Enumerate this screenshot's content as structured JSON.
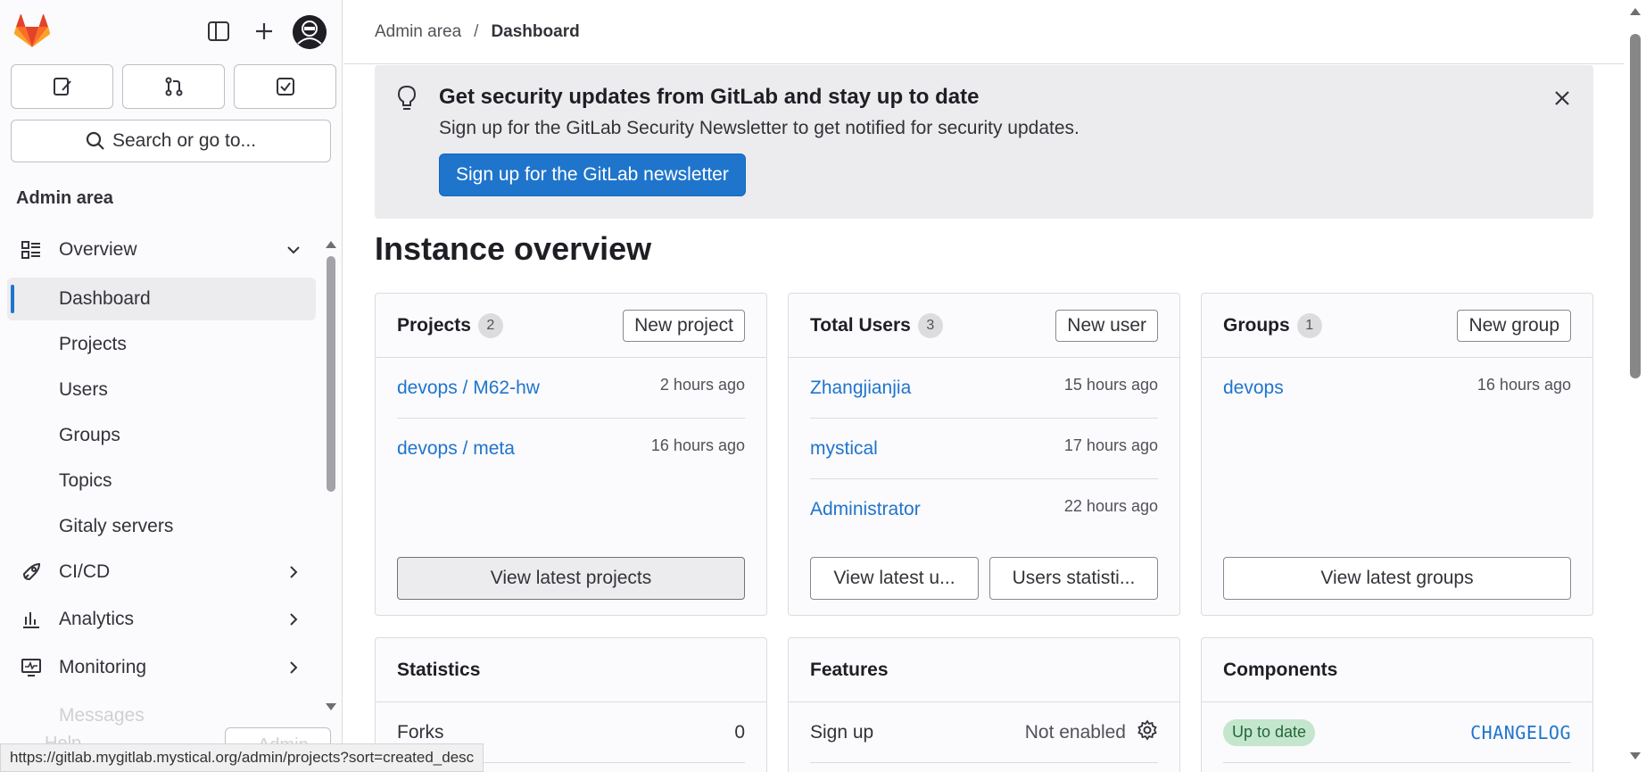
{
  "sidebar": {
    "section_title": "Admin area",
    "search_label": "Search or go to...",
    "nav": [
      {
        "label": "Overview",
        "icon": "overview-icon",
        "expanded": true
      },
      {
        "label": "Dashboard",
        "active": true
      },
      {
        "label": "Projects"
      },
      {
        "label": "Users"
      },
      {
        "label": "Groups"
      },
      {
        "label": "Topics"
      },
      {
        "label": "Gitaly servers"
      },
      {
        "label": "CI/CD",
        "icon": "rocket-icon"
      },
      {
        "label": "Analytics",
        "icon": "chart-icon"
      },
      {
        "label": "Monitoring",
        "icon": "monitor-icon"
      },
      {
        "label": "Messages"
      }
    ],
    "help_label": "Help",
    "admin_label": "Admin"
  },
  "breadcrumb": {
    "first": "Admin area",
    "separator": "/",
    "current": "Dashboard"
  },
  "banner": {
    "title": "Get security updates from GitLab and stay up to date",
    "text": "Sign up for the GitLab Security Newsletter to get notified for security updates.",
    "button": "Sign up for the GitLab newsletter"
  },
  "page_title": "Instance overview",
  "projects_card": {
    "title": "Projects",
    "count": "2",
    "new_button": "New project",
    "rows": [
      {
        "name": "devops / M62-hw",
        "time": "2 hours ago"
      },
      {
        "name": "devops / meta",
        "time": "16 hours ago"
      }
    ],
    "footer_button": "View latest projects"
  },
  "users_card": {
    "title": "Total Users",
    "count": "3",
    "new_button": "New user",
    "rows": [
      {
        "name": "Zhangjianjia",
        "time": "15 hours ago"
      },
      {
        "name": "mystical",
        "time": "17 hours ago"
      },
      {
        "name": "Administrator",
        "time": "22 hours ago"
      }
    ],
    "footer_buttons": [
      "View latest u...",
      "Users statisti..."
    ]
  },
  "groups_card": {
    "title": "Groups",
    "count": "1",
    "new_button": "New group",
    "rows": [
      {
        "name": "devops",
        "time": "16 hours ago"
      }
    ],
    "footer_button": "View latest groups"
  },
  "statistics_card": {
    "title": "Statistics",
    "rows": [
      {
        "label": "Forks",
        "value": "0"
      }
    ]
  },
  "features_card": {
    "title": "Features",
    "rows": [
      {
        "label": "Sign up",
        "value": "Not enabled"
      }
    ]
  },
  "components_card": {
    "title": "Components",
    "badge": "Up to date",
    "link": "CHANGELOG"
  },
  "status_url": "https://gitlab.mygitlab.mystical.org/admin/projects?sort=created_desc",
  "colors": {
    "brand_orange": "#e24329",
    "link_blue": "#1f75cb",
    "success_green": "#24663b"
  }
}
